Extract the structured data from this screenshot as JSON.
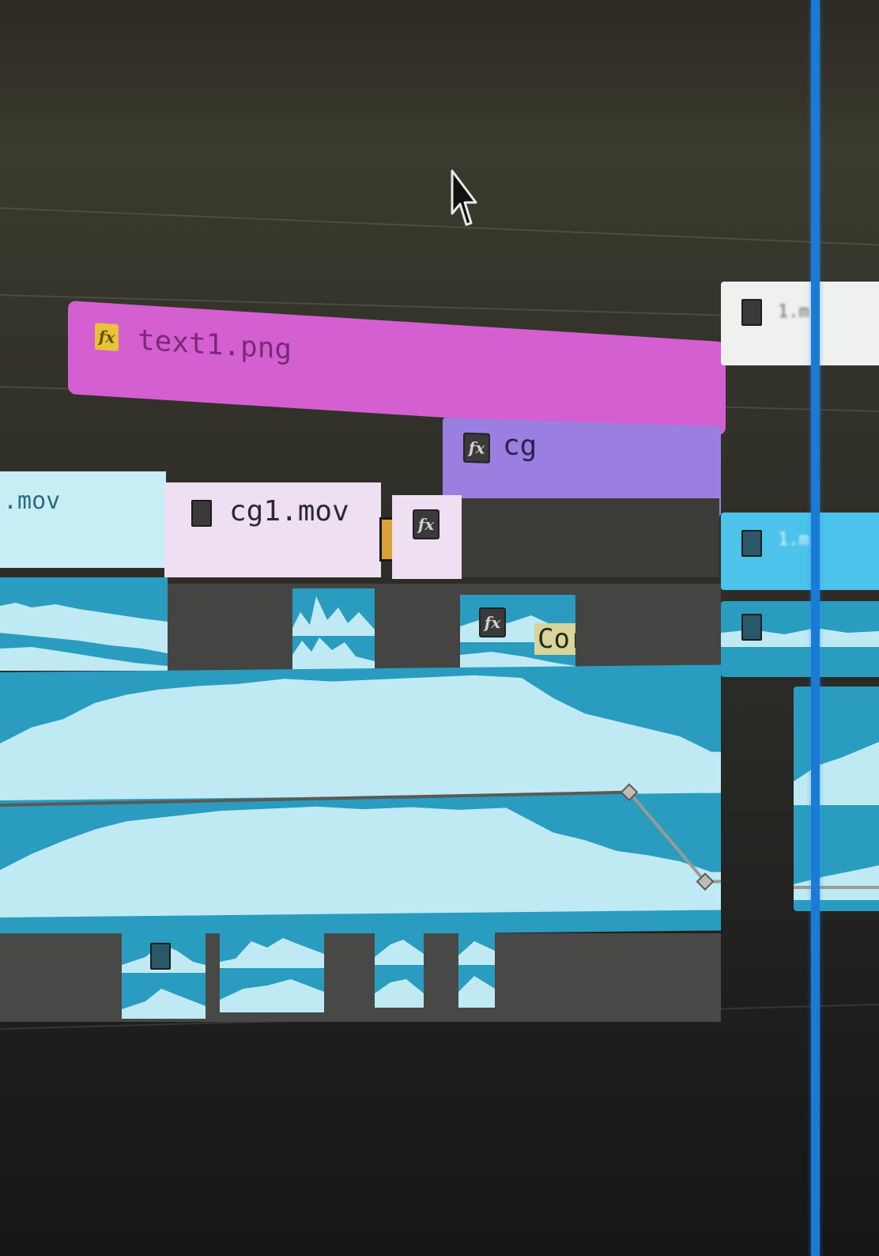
{
  "timeline": {
    "clips": {
      "text_clip": {
        "name": "text1.png",
        "badge": "fx",
        "color": "#d45fd0"
      },
      "cg_clip": {
        "name": "cg",
        "badge": "fx",
        "color": "#9b7fe0"
      },
      "mov_left": {
        "name": ".mov",
        "color": "#c8eef5"
      },
      "cg1_mov": {
        "name": "cg1.mov",
        "color": "#eedff2"
      },
      "fx_clip_small": {
        "badge": "fx"
      },
      "audio_fx_clip": {
        "badge": "fx",
        "label": "Cor"
      },
      "right_top_clip": {
        "name": "1.m"
      },
      "right_mid_clip": {
        "name": "1.m"
      }
    },
    "playhead_color": "#1a7bd6",
    "audio_color": "#2a9cc0",
    "audio_wave_color": "#bfeaf3"
  }
}
